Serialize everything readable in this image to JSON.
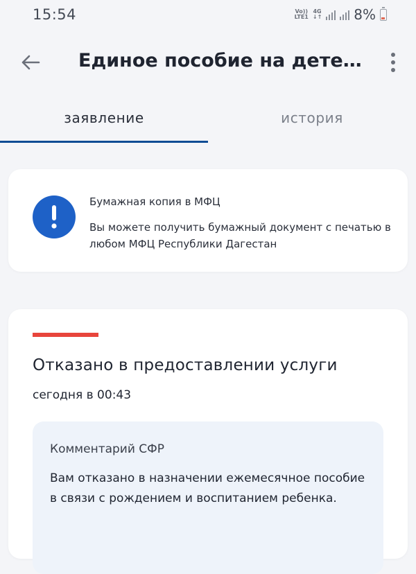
{
  "status_bar": {
    "time": "15:54",
    "volte_top": "Vo))",
    "volte_bottom": "LTE1",
    "network_top": "4G",
    "network_bottom": "↓↑",
    "battery_percent": "8%"
  },
  "app_bar": {
    "title": "Единое пособие на детей и б..."
  },
  "tabs": [
    {
      "label": "заявление",
      "active": true
    },
    {
      "label": "история",
      "active": false
    }
  ],
  "info_card": {
    "title": "Бумажная копия в МФЦ",
    "text": "Вы можете получить бумажный документ с печатью в любом МФЦ Республики Дагестан"
  },
  "status_card": {
    "status_color": "#e8453c",
    "title": "Отказано в предоставлении услуги",
    "time": "сегодня в 00:43",
    "comment": {
      "title": "Комментарий СФР",
      "text": "Вам отказано в назначении ежемесячное пособие в связи с рождением и воспитанием ребенка."
    }
  },
  "colors": {
    "accent": "#0d4c94",
    "info_icon": "#1e61c7",
    "background": "#f4f5f8"
  }
}
